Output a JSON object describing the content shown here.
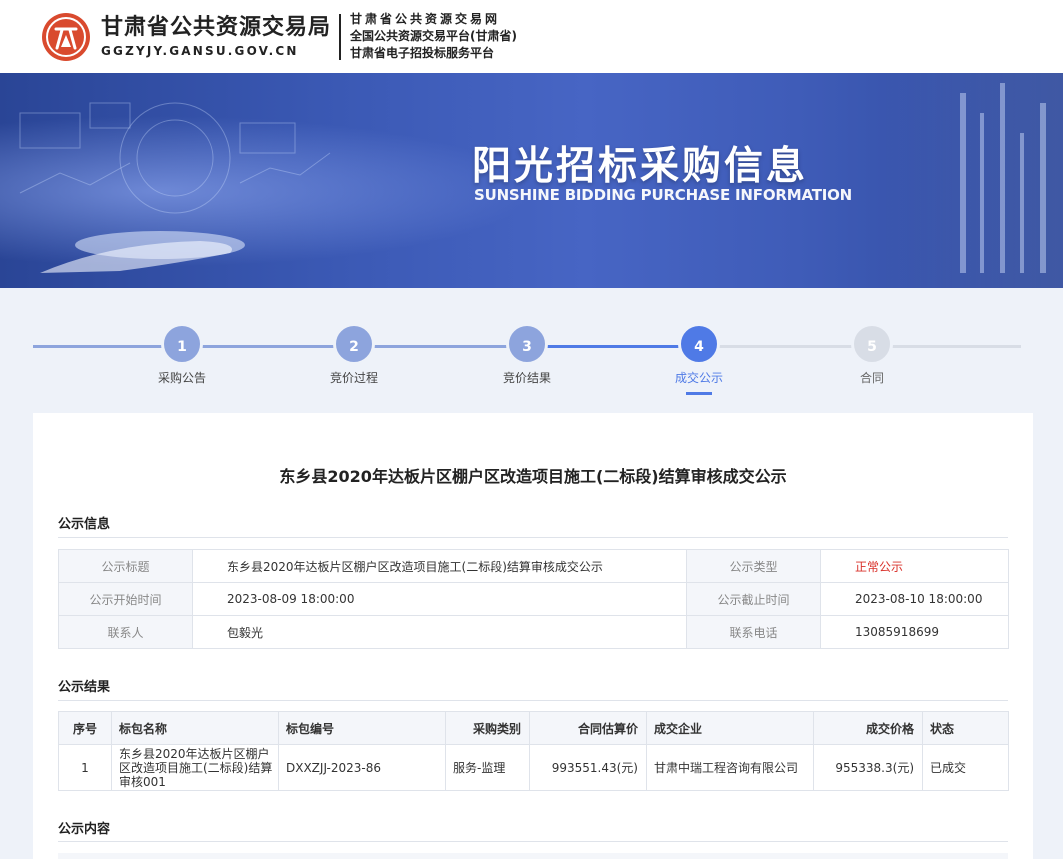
{
  "header": {
    "logo_cn": "甘肃省公共资源交易局",
    "logo_en": "GGZYJY.GANSU.GOV.CN",
    "line1": "甘肃省公共资源交易网",
    "line2": "全国公共资源交易平台(甘肃省)",
    "line3": "甘肃省电子招投标服务平台"
  },
  "banner": {
    "title": "阳光招标采购信息",
    "subtitle": "SUNSHINE BIDDING PURCHASE INFORMATION"
  },
  "steps": [
    {
      "num": "1",
      "label": "采购公告",
      "state": "done"
    },
    {
      "num": "2",
      "label": "竞价过程",
      "state": "done"
    },
    {
      "num": "3",
      "label": "竞价结果",
      "state": "done"
    },
    {
      "num": "4",
      "label": "成交公示",
      "state": "active"
    },
    {
      "num": "5",
      "label": "合同",
      "state": "todo"
    }
  ],
  "doc": {
    "title": "东乡县2020年达板片区棚户区改造项目施工(二标段)结算审核成交公示"
  },
  "info": {
    "heading": "公示信息",
    "rows": [
      {
        "k1": "公示标题",
        "v1": "东乡县2020年达板片区棚户区改造项目施工(二标段)结算审核成交公示",
        "k2": "公示类型",
        "v2": "正常公示"
      },
      {
        "k1": "公示开始时间",
        "v1": "2023-08-09 18:00:00",
        "k2": "公示截止时间",
        "v2": "2023-08-10 18:00:00"
      },
      {
        "k1": "联系人",
        "v1": "包毅光",
        "k2": "联系电话",
        "v2": "13085918699"
      }
    ]
  },
  "result": {
    "heading": "公示结果",
    "headers": [
      "序号",
      "标包名称",
      "标包编号",
      "采购类别",
      "合同估算价",
      "成交企业",
      "成交价格",
      "状态"
    ],
    "rows": [
      [
        "1",
        "东乡县2020年达板片区棚户区改造项目施工(二标段)结算审核001",
        "DXXZJJ-2023-86",
        "服务-监理",
        "993551.43(元)",
        "甘肃中瑞工程咨询有限公司",
        "955338.3(元)",
        "已成交"
      ]
    ]
  },
  "content": {
    "heading": "公示内容"
  },
  "colors": {
    "accent": "#4f7ae6",
    "step_done": "#8da4dd",
    "status_red": "#d9302a",
    "logo_red": "#d94a2e"
  }
}
